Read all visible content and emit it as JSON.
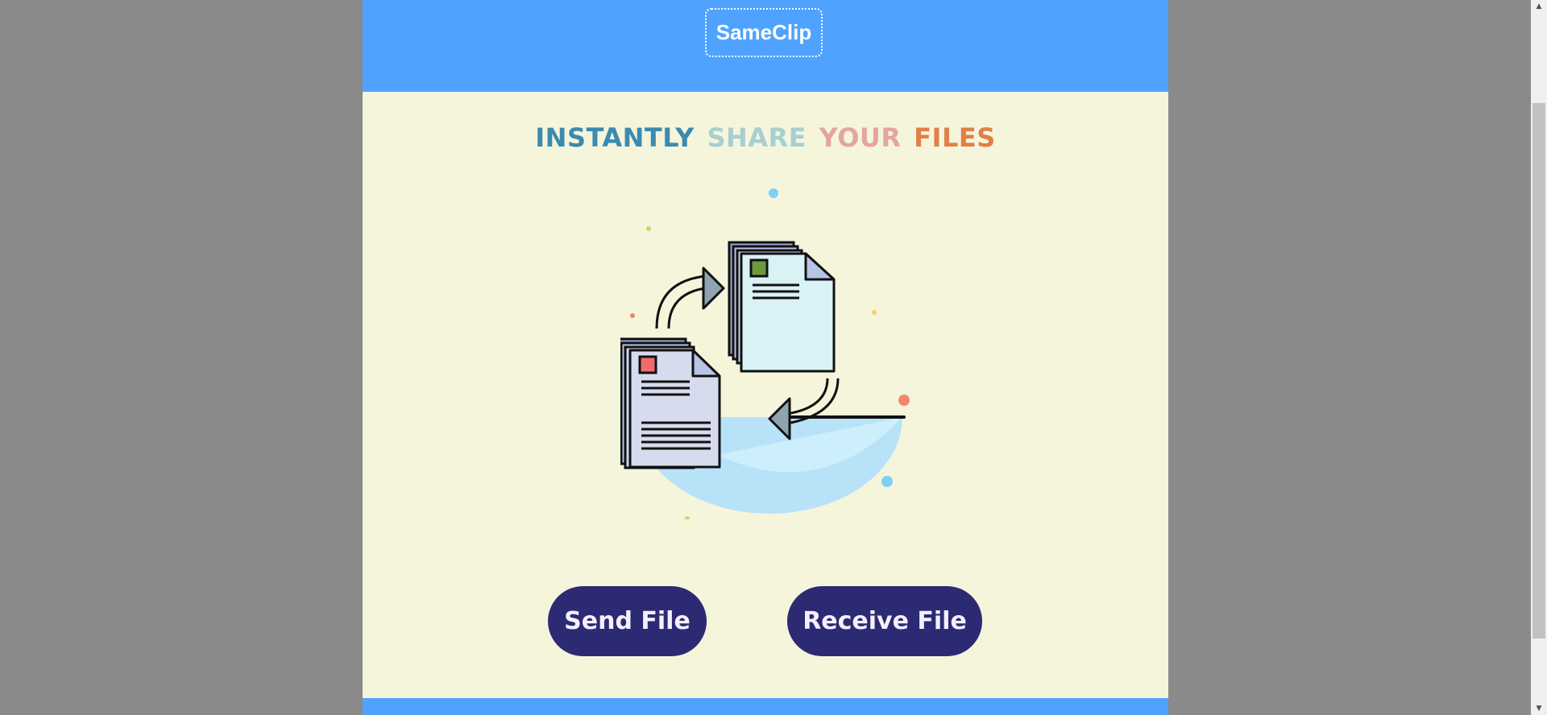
{
  "header": {
    "brand": "SameClip"
  },
  "headline": {
    "words": [
      {
        "text": "INSTANTLY",
        "color": "#3a8bb0"
      },
      {
        "text": "SHARE",
        "color": "#a8cfd0"
      },
      {
        "text": "YOUR",
        "color": "#e5a4a4"
      },
      {
        "text": "FILES",
        "color": "#e08048"
      }
    ]
  },
  "illustration": {
    "icon": "file-transfer-illustration"
  },
  "actions": {
    "send_label": "Send File",
    "receive_label": "Receive File"
  },
  "colors": {
    "header_bg": "#4fa3ff",
    "page_bg": "#f5f5dc",
    "button_bg": "#2b2a72",
    "outer_bg": "#8a8a8a"
  }
}
